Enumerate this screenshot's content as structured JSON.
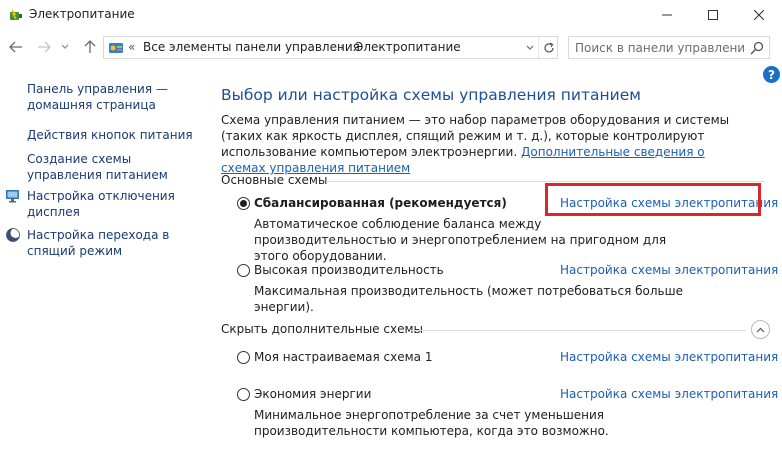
{
  "window": {
    "title": "Электропитание",
    "minimize_glyph": "—",
    "maximize_glyph": "☐",
    "close_glyph": "✕"
  },
  "nav": {
    "back_glyph": "←",
    "forward_glyph": "→",
    "recent_glyph": "⌄",
    "up_glyph": "↑",
    "refresh_glyph": "↻",
    "breadcrumb": {
      "root_sep": "«",
      "seg1": "Все элементы панели управления",
      "sep": "›",
      "seg2": "Электропитание"
    },
    "search": {
      "placeholder": "Поиск в панели управления",
      "value": ""
    }
  },
  "help": {
    "glyph": "?"
  },
  "sidebar": {
    "home": "Панель управления — домашняя страница",
    "items": [
      {
        "label": "Действия кнопок питания"
      },
      {
        "label": "Создание схемы управления питанием"
      },
      {
        "label": "Настройка отключения дисплея"
      },
      {
        "label": "Настройка перехода в спящий режим"
      }
    ]
  },
  "main": {
    "title": "Выбор или настройка схемы управления питанием",
    "description": "Схема управления питанием — это набор параметров оборудования и системы (таких как яркость дисплея, спящий режим и т. д.), которые контролируют использование компьютером электроэнергии.",
    "description_link": "Дополнительные сведения о схемах управления питанием",
    "section_main": "Основные схемы",
    "section_hidden": "Скрыть дополнительные схемы",
    "plan_link_label": "Настройка схемы электропитания",
    "plans": [
      {
        "name": "Сбалансированная (рекомендуется)",
        "selected": true,
        "description": "Автоматическое соблюдение баланса между производительностью и энергопотреблением на пригодном для этого оборудовании."
      },
      {
        "name": "Высокая производительность",
        "selected": false,
        "description": "Максимальная производительность (может потребоваться больше энергии)."
      },
      {
        "name": "Моя настраиваемая схема 1",
        "selected": false,
        "description": ""
      },
      {
        "name": "Экономия энергии",
        "selected": false,
        "description": "Минимальное энергопотребление за счет уменьшения производительности компьютера, когда это возможно."
      }
    ]
  },
  "colors": {
    "title_blue": "#1e4f96",
    "link_blue": "#1a5fb4",
    "highlight_red": "#d9282c"
  }
}
